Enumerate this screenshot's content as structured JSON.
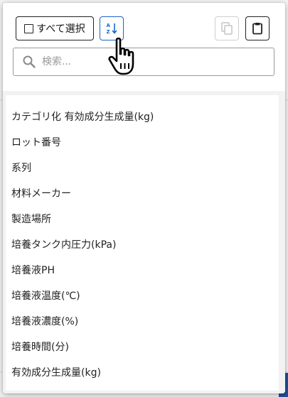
{
  "toolbar": {
    "select_all_label": "すべて選択",
    "sort_icon": "sort-alpha-down-icon",
    "copy_icon": "copy-icon",
    "paste_icon": "clipboard-icon"
  },
  "search": {
    "placeholder": "検索...",
    "value": ""
  },
  "list": {
    "items": [
      "カテゴリ化 有効成分生成量(kg)",
      "ロット番号",
      "系列",
      "材料メーカー",
      "製造場所",
      "培養タンク内圧力(kPa)",
      "培養液PH",
      "培養液温度(℃)",
      "培養液濃度(%)",
      "培養時間(分)",
      "有効成分生成量(kg)"
    ]
  },
  "colors": {
    "accent": "#1c63c9",
    "border_dark": "#222222",
    "border_disabled": "#cfcfcf",
    "background_blue": "#1f4e9c"
  }
}
